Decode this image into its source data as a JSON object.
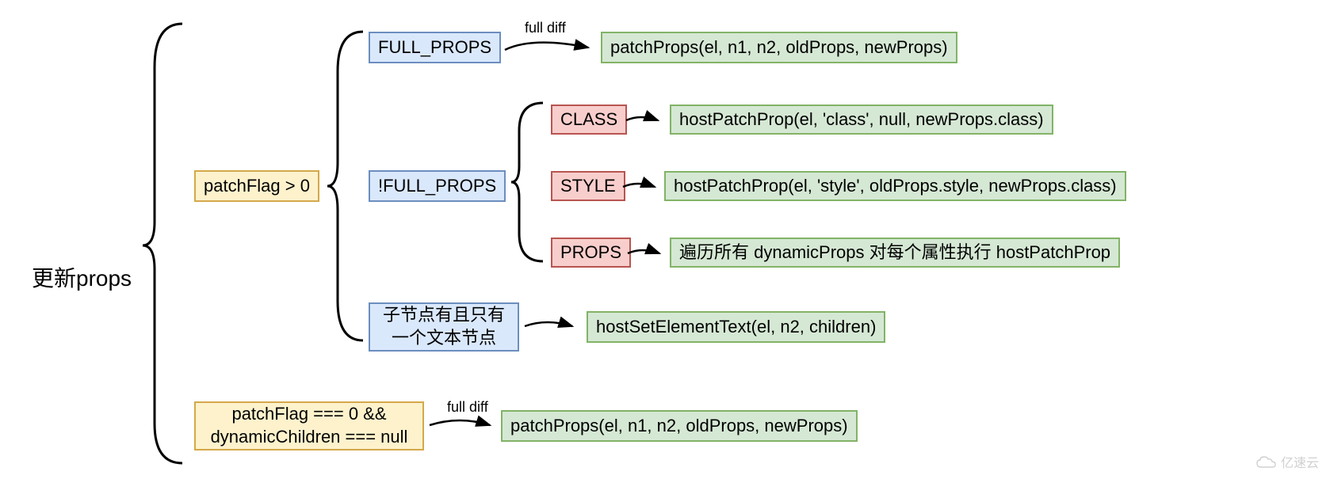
{
  "root": "更新props",
  "cond1": {
    "label": "patchFlag > 0",
    "branch_full": {
      "label": "FULL_PROPS",
      "arrow_label": "full diff",
      "result": "patchProps(el, n1, n2, oldProps, newProps)"
    },
    "branch_notfull": {
      "label": "!FULL_PROPS",
      "sub": {
        "class": {
          "label": "CLASS",
          "result": "hostPatchProp(el, 'class', null, newProps.class)"
        },
        "style": {
          "label": "STYLE",
          "result": "hostPatchProp(el, 'style', oldProps.style, newProps.class)"
        },
        "props": {
          "label": "PROPS",
          "result": "遍历所有 dynamicProps 对每个属性执行 hostPatchProp"
        }
      }
    },
    "branch_text": {
      "label": "子节点有且只有一个文本节点",
      "result": "hostSetElementText(el, n2, children)"
    }
  },
  "cond2": {
    "label": "patchFlag === 0  && dynamicChildren === null",
    "arrow_label": "full diff",
    "result": "patchProps(el, n1, n2, oldProps, newProps)"
  },
  "watermark": "亿速云"
}
